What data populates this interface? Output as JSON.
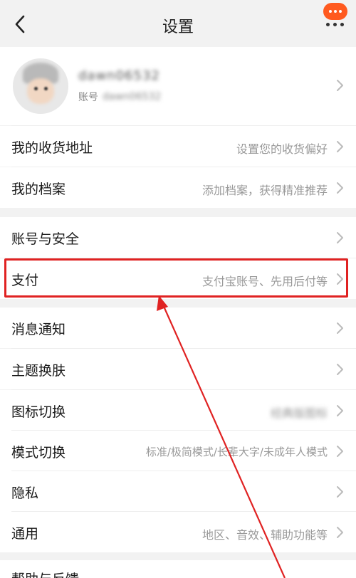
{
  "header": {
    "title": "设置",
    "back_icon": "chevron-left-icon",
    "more_icon": "more-icon"
  },
  "profile": {
    "username": "dawn06532",
    "account_label": "账号",
    "account_value": "dawn06532"
  },
  "sections": [
    {
      "key": "address",
      "label": "我的收货地址",
      "value": "设置您的收货偏好"
    },
    {
      "key": "profile_file",
      "label": "我的档案",
      "value": "添加档案，获得精准推荐"
    },
    {
      "key": "security",
      "label": "账号与安全",
      "value": ""
    },
    {
      "key": "payment",
      "label": "支付",
      "value": "支付宝账号、先用后付等"
    },
    {
      "key": "notifications",
      "label": "消息通知",
      "value": ""
    },
    {
      "key": "theme",
      "label": "主题换肤",
      "value": ""
    },
    {
      "key": "icon_switch",
      "label": "图标切换",
      "value": "经典版图标"
    },
    {
      "key": "mode_switch",
      "label": "模式切换",
      "value": "标准/极简模式/长辈大字/未成年人模式"
    },
    {
      "key": "privacy",
      "label": "隐私",
      "value": ""
    },
    {
      "key": "general",
      "label": "通用",
      "value": "地区、音效、辅助功能等"
    },
    {
      "key": "help",
      "label": "帮助与反馈",
      "value": ""
    }
  ],
  "colors": {
    "accent": "#ff5a1f",
    "highlight": "#e02222",
    "text": "#1a1a1a",
    "secondary": "#999999"
  }
}
